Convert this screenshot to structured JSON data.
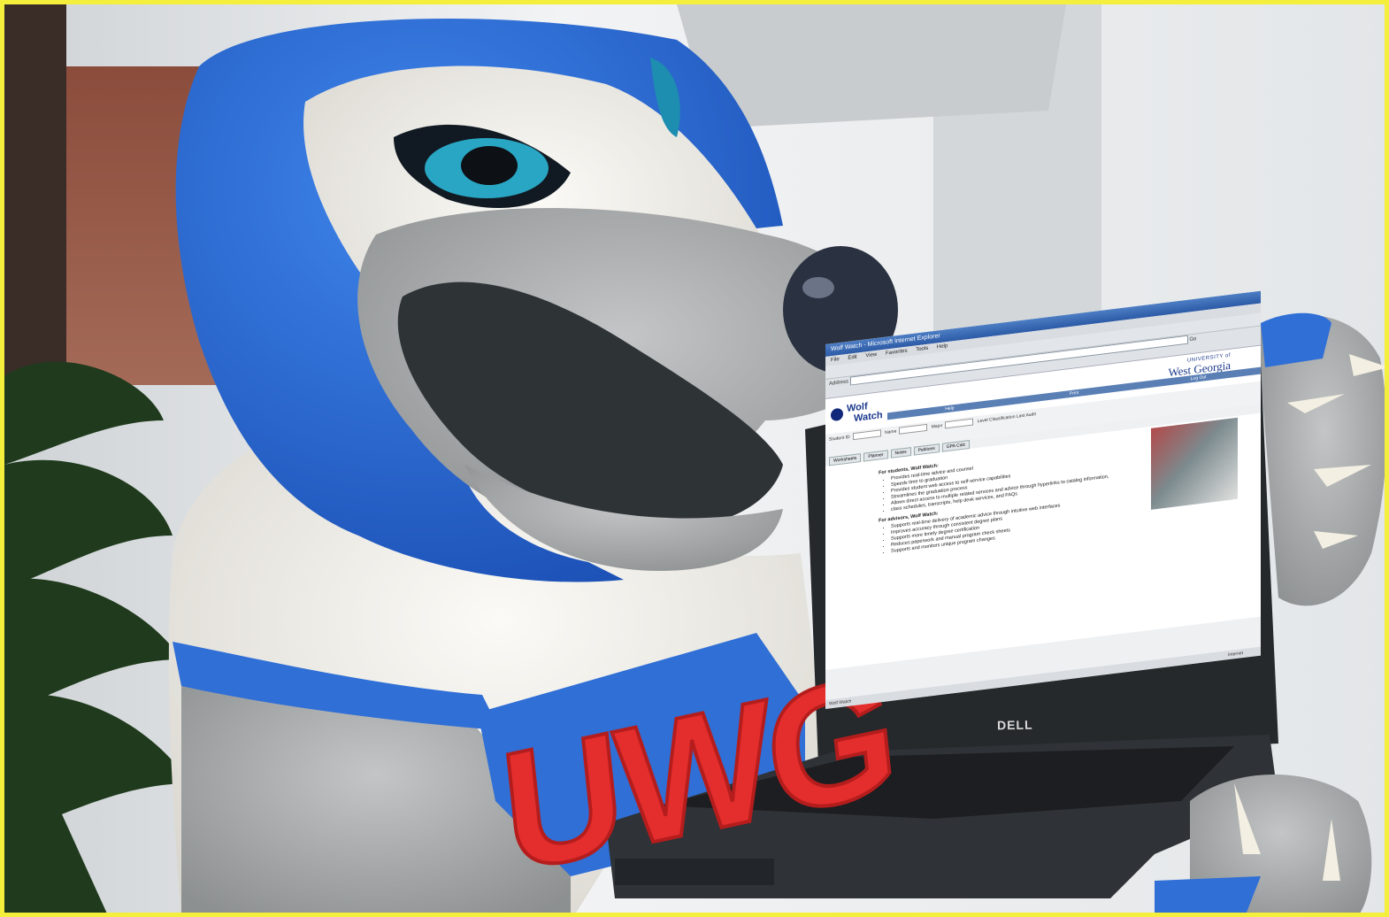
{
  "image": {
    "border_color": "#f4ee3c",
    "mascot_colors": {
      "blue": "#2f6fd6",
      "white": "#f2f0ea",
      "gray": "#a7a9aa",
      "nose": "#2a3140"
    },
    "jersey_letters": "UWG",
    "laptop_brand": "DELL"
  },
  "browser": {
    "title": "Wolf Watch - Microsoft Internet Explorer",
    "menu": [
      "File",
      "Edit",
      "View",
      "Favorites",
      "Tools",
      "Help"
    ],
    "address_label": "Address",
    "go_label": "Go",
    "status_left": "Wolf Watch",
    "status_right": "Internet"
  },
  "wolfwatch": {
    "logo_line1": "Wolf",
    "logo_line2": "Watch",
    "univ_line1": "UNIVERSITY of",
    "univ_line2": "West Georgia",
    "nav": [
      "Help",
      "Print",
      "Log Out"
    ],
    "filters": {
      "student_id": "Student ID",
      "name": "Name",
      "major": "Major",
      "level": "Level",
      "classification": "Classification",
      "last_audit": "Last Audit"
    },
    "tabs": [
      "Worksheets",
      "Planner",
      "Notes",
      "Petitions",
      "GPA Calc"
    ],
    "students_heading": "For students, Wolf Watch:",
    "students_items": [
      "Provides real-time advice and counsel",
      "Speeds time to graduation",
      "Provides student web access to self-service capabilities",
      "Streamlines the graduation process",
      "Allows direct access to multiple related services and advice through hyperlinks to catalog information,",
      "class schedules, transcripts, help desk services, and FAQs"
    ],
    "advisors_heading": "For advisors, Wolf Watch:",
    "advisors_items": [
      "Supports real-time delivery of academic advice through intuitive web interfaces",
      "Improves accuracy through consistent degree plans",
      "Supports more timely degree certification",
      "Reduces paperwork and manual program check sheets",
      "Supports and monitors unique program changes"
    ]
  }
}
